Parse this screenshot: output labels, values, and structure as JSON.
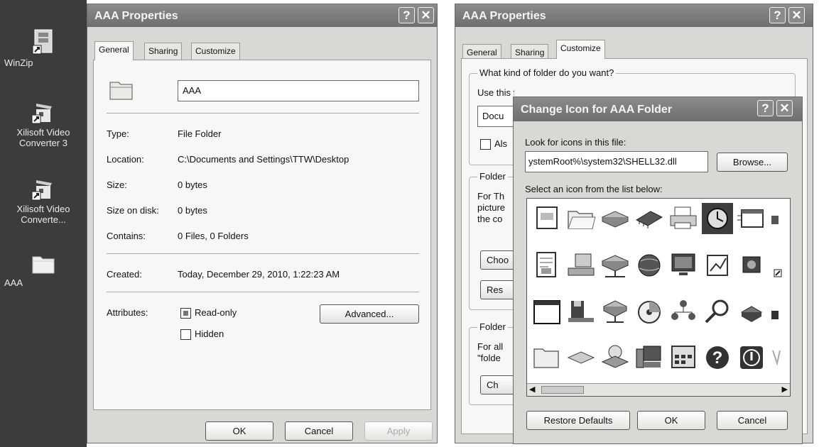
{
  "desktop": {
    "icons": [
      {
        "name": "winzip",
        "label": "WinZip"
      },
      {
        "name": "xilisoft-converter-3",
        "label": "Xilisoft Video Converter 3"
      },
      {
        "name": "xilisoft-converter",
        "label": "Xilisoft Video Converte..."
      },
      {
        "name": "aaa-folder",
        "label": "AAA"
      }
    ]
  },
  "props_left": {
    "title": "AAA Properties",
    "help_glyph": "?",
    "close_glyph": "✕",
    "tabs": [
      "General",
      "Sharing",
      "Customize"
    ],
    "folder_name": "AAA",
    "labels": {
      "type": "Type:",
      "location": "Location:",
      "size": "Size:",
      "size_on_disk": "Size on disk:",
      "contains": "Contains:",
      "created": "Created:",
      "attributes": "Attributes:"
    },
    "values": {
      "type": "File Folder",
      "location": "C:\\Documents and Settings\\TTW\\Desktop",
      "size": "0 bytes",
      "size_on_disk": "0 bytes",
      "contains": "0 Files, 0 Folders",
      "created": "Today, December 29, 2010, 1:22:23 AM"
    },
    "readonly_label": "Read-only",
    "hidden_label": "Hidden",
    "advanced_button": "Advanced...",
    "ok_button": "OK",
    "cancel_button": "Cancel",
    "apply_button": "Apply"
  },
  "props_right": {
    "title": "AAA Properties",
    "help_glyph": "?",
    "close_glyph": "✕",
    "tabs": [
      "General",
      "Sharing",
      "Customize"
    ],
    "what_kind": "What kind of folder do you want?",
    "use_this_partial": "Use this folder type as a template:",
    "template_partial": "Docu",
    "also_partial": "Als",
    "folder_pictures_partial": "Folder",
    "for_this_partial": "For Th",
    "picture_partial": "picture",
    "the_co_partial": "the co",
    "choose_partial_1": "Choo",
    "restore_partial": "Res",
    "folder_icons_partial": "Folder",
    "for_all_partial": "For all",
    "folder_quote_partial": "\"folde",
    "change_partial": "Ch"
  },
  "change_icon": {
    "title": "Change Icon for AAA Folder",
    "help_glyph": "?",
    "close_glyph": "✕",
    "look_label": "Look for icons in this file:",
    "file_path": "ystemRoot%\\system32\\SHELL32.dll",
    "browse_button": "Browse...",
    "select_label": "Select an icon from the list below:",
    "icon_rows": [
      [
        "file-icon",
        "open-folder-icon",
        "drive-icon",
        "chip-icon",
        "printer-icon",
        "clock-icon",
        "window-icon",
        "partial-icon"
      ],
      [
        "document-icon",
        "computer-icon",
        "network-drive-icon",
        "globe-icon",
        "monitor-icon",
        "chart-icon",
        "speaker-icon",
        "shortcut-icon"
      ],
      [
        "window-blank-icon",
        "floppy-icon",
        "network-icon",
        "cd-icon",
        "users-icon",
        "search-icon",
        "disk-icon",
        "small-icon"
      ],
      [
        "folder-icon",
        "flat-drive-icon",
        "cd-drive-icon",
        "desktop-computer-icon",
        "calculator-icon",
        "help-icon",
        "shutdown-icon",
        "cut-icon"
      ]
    ],
    "scroll_left_glyph": "◀",
    "scroll_right_glyph": "▶",
    "restore_defaults_button": "Restore Defaults",
    "ok_button": "OK",
    "cancel_button": "Cancel"
  }
}
